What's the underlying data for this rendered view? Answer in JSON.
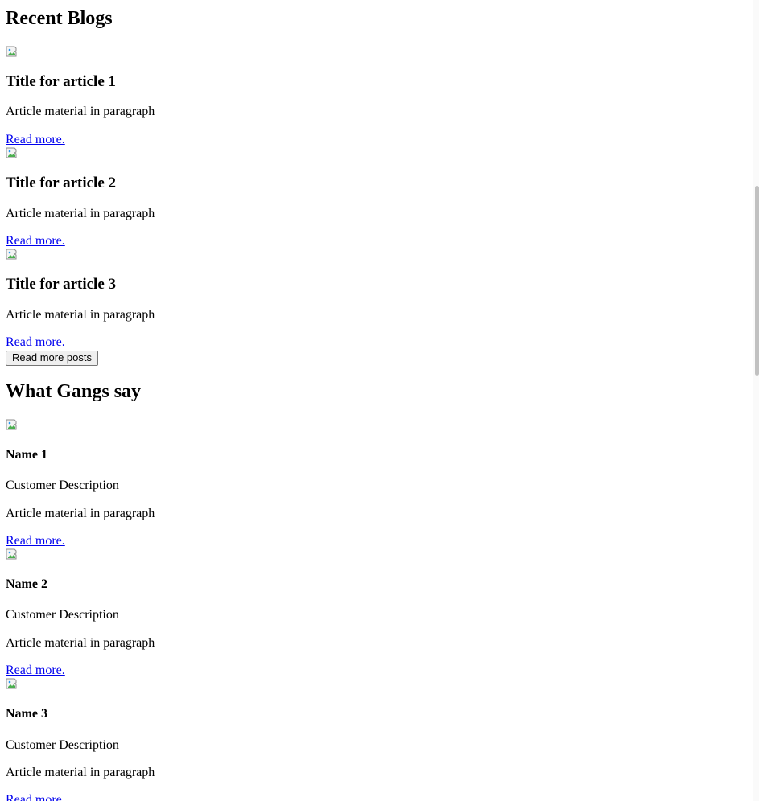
{
  "blogs": {
    "heading": "Recent Blogs",
    "articles": [
      {
        "title": "Title for article 1",
        "body": "Article material in paragraph",
        "link": "Read more."
      },
      {
        "title": "Title for article 2",
        "body": "Article material in paragraph",
        "link": "Read more."
      },
      {
        "title": "Title for article 3",
        "body": "Article material in paragraph",
        "link": "Read more."
      }
    ],
    "button_label": "Read more posts"
  },
  "testimonials": {
    "heading": "What Gangs say",
    "items": [
      {
        "name": "Name 1",
        "description": "Customer Description",
        "body": "Article material in paragraph",
        "link": "Read more."
      },
      {
        "name": "Name 2",
        "description": "Customer Description",
        "body": "Article material in paragraph",
        "link": "Read more."
      },
      {
        "name": "Name 3",
        "description": "Customer Description",
        "body": "Article material in paragraph",
        "link": "Read more."
      }
    ]
  },
  "icons": {
    "image": "broken-image-icon"
  },
  "colors": {
    "link": "#0000ee",
    "text": "#000000",
    "background": "#ffffff"
  }
}
